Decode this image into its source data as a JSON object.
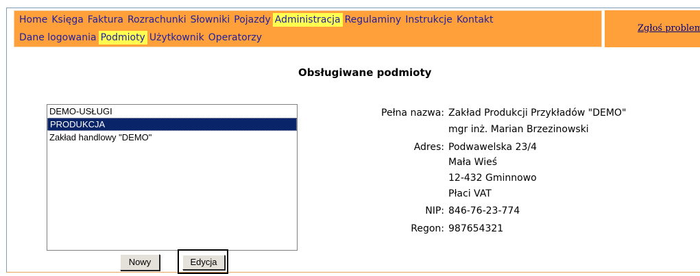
{
  "menu": {
    "row1": [
      {
        "label": "Home",
        "active": false
      },
      {
        "label": "Księga",
        "active": false
      },
      {
        "label": "Faktura",
        "active": false
      },
      {
        "label": "Rozrachunki",
        "active": false
      },
      {
        "label": "Słowniki",
        "active": false
      },
      {
        "label": "Pojazdy",
        "active": false
      },
      {
        "label": "Administracja",
        "active": true
      },
      {
        "label": "Regulaminy",
        "active": false
      },
      {
        "label": "Instrukcje",
        "active": false
      },
      {
        "label": "Kontakt",
        "active": false
      }
    ],
    "row2": [
      {
        "label": "Dane logowania",
        "active": false
      },
      {
        "label": "Podmioty",
        "active": true
      },
      {
        "label": "Użytkownik",
        "active": false
      },
      {
        "label": "Operatorzy",
        "active": false
      }
    ]
  },
  "report_link": "Zgłoś problem",
  "page_title": "Obsługiwane podmioty",
  "entities": {
    "items": [
      "DEMO-USŁUGI",
      "PRODUKCJA",
      "Zakład handlowy \"DEMO\""
    ],
    "selected_index": 1
  },
  "buttons": {
    "new": "Nowy",
    "edit": "Edycja"
  },
  "details": {
    "full_name_label": "Pełna nazwa:",
    "full_name": "Zakład Produkcji Przykładów \"DEMO\"",
    "owner": "mgr inż. Marian Brzezinowski",
    "address_label": "Adres:",
    "address_line1": "Podwawelska 23/4",
    "address_line2": "Mała Wieś",
    "address_line3": "12-432 Gminnowo",
    "vat": "Płaci VAT",
    "nip_label": "NIP:",
    "nip": "846-76-23-774",
    "regon_label": "Regon:",
    "regon": "987654321"
  },
  "colors": {
    "menu_bg": "#ffa03a",
    "menu_active": "#ffff4f",
    "selection": "#0a246a"
  }
}
